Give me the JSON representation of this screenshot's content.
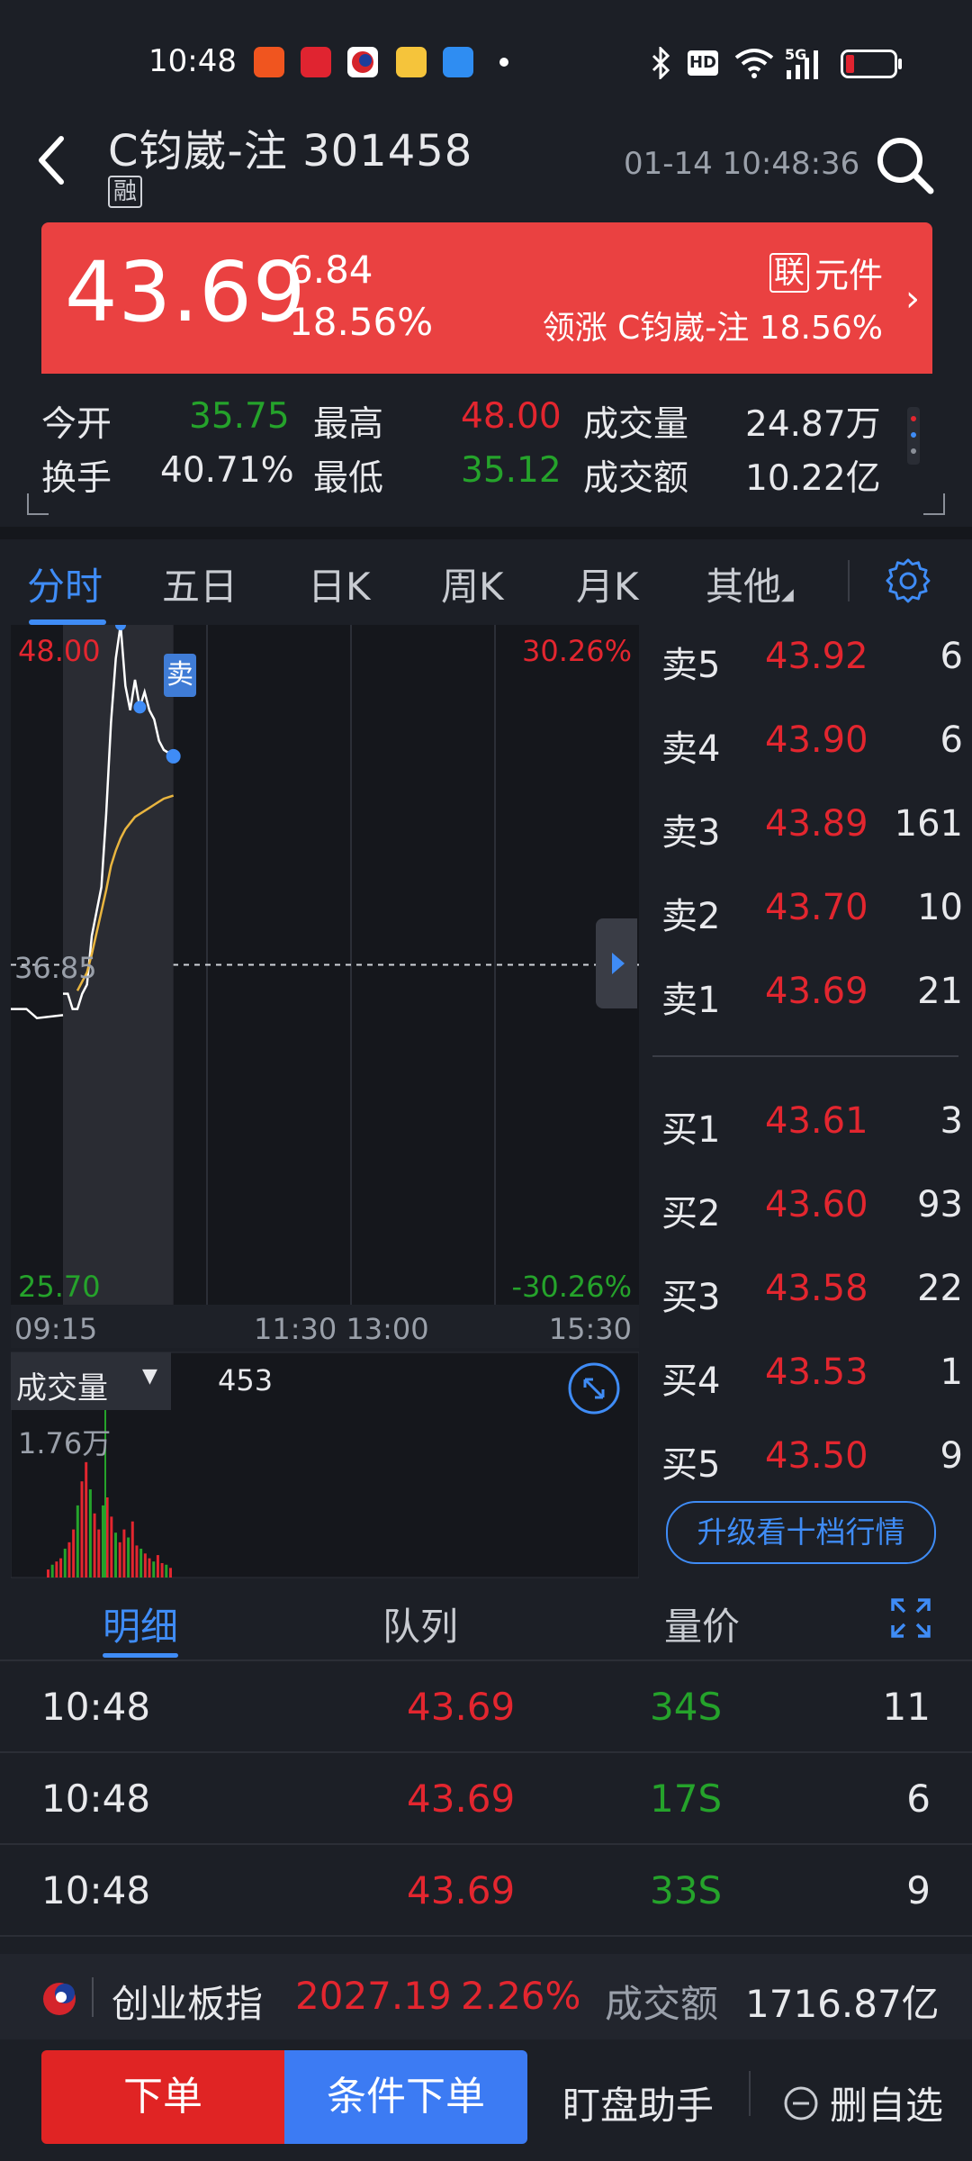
{
  "status_bar": {
    "time": "10:48",
    "app_icons": [
      "app-red-icon",
      "cart-icon",
      "stock-app-icon",
      "notes-icon",
      "briefcase-icon"
    ],
    "right_icons": [
      "bluetooth-icon",
      "hd-icon",
      "wifi-icon",
      "5g-signal-icon",
      "battery-low-icon"
    ]
  },
  "header": {
    "title": "C钧崴-注 301458",
    "badge": "融",
    "datetime": "01-14 10:48:36"
  },
  "quote": {
    "price": "43.69",
    "change": "6.84",
    "change_pct": "18.56%",
    "lian_badge": "联",
    "sector": "元件",
    "lead_label": "领涨 C钧崴-注 18.56%"
  },
  "stats": {
    "open_label": "今开",
    "open": "35.75",
    "high_label": "最高",
    "high": "48.00",
    "vol_label": "成交量",
    "vol": "24.87万",
    "turnover_label": "换手",
    "turnover": "40.71%",
    "low_label": "最低",
    "low": "35.12",
    "amount_label": "成交额",
    "amount": "10.22亿"
  },
  "tabs": [
    "分时",
    "五日",
    "日K",
    "周K",
    "月K",
    "其他"
  ],
  "chart": {
    "price_top": "48.00",
    "pct_top": "30.26%",
    "price_mid": "36.85",
    "price_bottom": "25.70",
    "pct_bottom": "-30.26%",
    "times": [
      "09:15",
      "11:30 13:00",
      "15:30"
    ],
    "sell_marker": "卖",
    "volume_label": "成交量",
    "volume_value": "453",
    "volume_max": "1.76万"
  },
  "chart_data": {
    "type": "line",
    "title": "",
    "xlabel": "",
    "ylabel": "",
    "x_ticks": [
      "09:15",
      "11:30 13:00",
      "15:30"
    ],
    "ylim": [
      25.7,
      48.0
    ],
    "ref_price": 36.85,
    "series": [
      {
        "x": [
          0,
          2,
          4,
          6,
          8,
          10,
          12,
          14,
          16,
          18,
          20,
          22,
          24,
          26,
          28,
          30,
          32,
          34,
          36,
          38,
          40,
          42,
          44,
          46
        ],
        "y": [
          35.9,
          35.9,
          35.4,
          35.4,
          35.9,
          36.2,
          37.8,
          38.6,
          39.4,
          41.8,
          44.8,
          46.9,
          48.0,
          46.0,
          45.2,
          46.2,
          45.3,
          45.8,
          45.2,
          44.9,
          44.2,
          43.9,
          43.8,
          43.69
        ]
      },
      {
        "x": [
          6,
          8,
          10,
          12,
          14,
          16,
          18,
          20,
          22,
          24,
          26,
          28,
          30,
          32,
          34,
          36,
          38,
          40,
          42,
          44,
          46
        ],
        "y": [
          36.0,
          36.3,
          36.6,
          37.2,
          37.9,
          38.6,
          39.3,
          40.1,
          40.6,
          41.0,
          41.3,
          41.5,
          41.7,
          41.8,
          41.9,
          42.0,
          42.1,
          42.2,
          42.3,
          42.35,
          42.4
        ]
      }
    ]
  },
  "order_book": {
    "asks": [
      {
        "label": "卖5",
        "price": "43.92",
        "vol": "6"
      },
      {
        "label": "卖4",
        "price": "43.90",
        "vol": "6"
      },
      {
        "label": "卖3",
        "price": "43.89",
        "vol": "161"
      },
      {
        "label": "卖2",
        "price": "43.70",
        "vol": "10"
      },
      {
        "label": "卖1",
        "price": "43.69",
        "vol": "21"
      }
    ],
    "bids": [
      {
        "label": "买1",
        "price": "43.61",
        "vol": "3"
      },
      {
        "label": "买2",
        "price": "43.60",
        "vol": "93"
      },
      {
        "label": "买3",
        "price": "43.58",
        "vol": "22"
      },
      {
        "label": "买4",
        "price": "43.53",
        "vol": "1"
      },
      {
        "label": "买5",
        "price": "43.50",
        "vol": "9"
      }
    ],
    "upgrade_label": "升级看十档行情"
  },
  "detail_tabs": [
    "明细",
    "队列",
    "量价"
  ],
  "trades": [
    {
      "time": "10:48",
      "price": "43.69",
      "vol": "34S",
      "count": "11"
    },
    {
      "time": "10:48",
      "price": "43.69",
      "vol": "17S",
      "count": "6"
    },
    {
      "time": "10:48",
      "price": "43.69",
      "vol": "33S",
      "count": "9"
    }
  ],
  "index_bar": {
    "name": "创业板指",
    "value": "2027.19",
    "pct": "2.26%",
    "amount_label": "成交额",
    "amount": "1716.87亿"
  },
  "actions": {
    "order": "下单",
    "conditional": "条件下单",
    "watch_helper": "盯盘助手",
    "remove_fav": "删自选"
  },
  "colors": {
    "up": "#e3262f",
    "down": "#25a32b",
    "accent": "#3f8cf6",
    "banner": "#ea4141"
  }
}
